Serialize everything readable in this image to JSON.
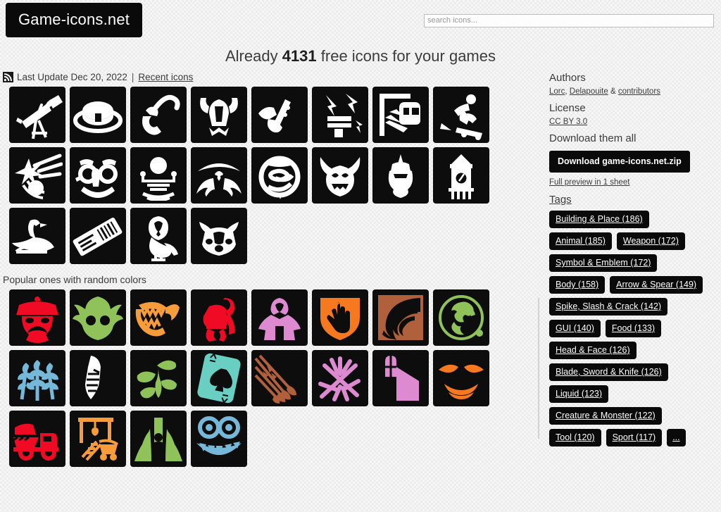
{
  "site": {
    "logo": "Game-icons.net",
    "headline_prefix": "Already ",
    "headline_count": "4131",
    "headline_suffix": " free icons for your games"
  },
  "search": {
    "placeholder": "search icons...",
    "value": "",
    "icon": "search-icon"
  },
  "update": {
    "rss_icon": "rss-feed-icon",
    "text": "Last Update Dec 20, 2022",
    "separator": "|",
    "recent_link": "Recent icons"
  },
  "sections": {
    "recent_title": "",
    "popular_title": "Popular ones with random colors"
  },
  "recent_icons": [
    {
      "name": "telescope-icon",
      "label": "Telescope"
    },
    {
      "name": "boater-hat-icon",
      "label": "Boater Hat"
    },
    {
      "name": "smoking-pipe-icon",
      "label": "Smoking Pipe"
    },
    {
      "name": "horned-helm-icon",
      "label": "Horned Helm"
    },
    {
      "name": "hand-grenade-icon",
      "label": "Hand Holding Vial"
    },
    {
      "name": "thunder-anvil-icon",
      "label": "Thunder Struck Anvil"
    },
    {
      "name": "subway-train-icon",
      "label": "Subway Train"
    },
    {
      "name": "skateboarder-icon",
      "label": "Skateboarder"
    },
    {
      "name": "comet-spark-icon",
      "label": "Comet Spark"
    },
    {
      "name": "groucho-glasses-icon",
      "label": "Groucho Glasses"
    },
    {
      "name": "orrery-icon",
      "label": "Orrery"
    },
    {
      "name": "manta-ray-icon",
      "label": "Manta Ray"
    },
    {
      "name": "planet-emblem-icon",
      "label": "Planet Emblem"
    },
    {
      "name": "goblin-head-icon",
      "label": "Goblin Head"
    },
    {
      "name": "knight-helm-icon",
      "label": "Knight Helm"
    },
    {
      "name": "clock-tower-icon",
      "label": "Clock Tower"
    },
    {
      "name": "goose-icon",
      "label": "Goose"
    },
    {
      "name": "boarding-pass-icon",
      "label": "Boarding Pass"
    },
    {
      "name": "barn-owl-icon",
      "label": "Barn Owl"
    },
    {
      "name": "badger-head-icon",
      "label": "Badger Head"
    }
  ],
  "popular_icons": [
    {
      "name": "police-officer-head-icon",
      "label": "Police Officer Head",
      "color": "#f00a23"
    },
    {
      "name": "fish-monster-head-icon",
      "label": "Fish Monster Head",
      "color": "#8fc359"
    },
    {
      "name": "shark-bite-icon",
      "label": "Shark Bite",
      "color": "#f79c3a"
    },
    {
      "name": "gorilla-icon",
      "label": "Gorilla",
      "color": "#f00a23"
    },
    {
      "name": "hooded-figure-icon",
      "label": "Hooded Figure",
      "color": "#dd8ad0"
    },
    {
      "name": "hand-shield-icon",
      "label": "Hand Shield",
      "color": "#f6791f"
    },
    {
      "name": "spiral-shell-icon",
      "label": "Spiral Shell",
      "color": "#b0603a"
    },
    {
      "name": "earth-globe-icon",
      "label": "Earth Globe",
      "color": "#8fc359"
    },
    {
      "name": "wheat-icon",
      "label": "Wheat",
      "color": "#75b8d9"
    },
    {
      "name": "gauntlet-icon",
      "label": "Gauntlet",
      "color": "#ffffff"
    },
    {
      "name": "sprout-icon",
      "label": "Sprout",
      "color": "#8fc359"
    },
    {
      "name": "ace-of-spades-icon",
      "label": "Ace Of Spades",
      "color": "#69cfc2"
    },
    {
      "name": "arrow-cluster-icon",
      "label": "Arrow Cluster",
      "color": "#b0603a"
    },
    {
      "name": "crossed-sticks-icon",
      "label": "Crossed Sticks",
      "color": "#dd8ad0"
    },
    {
      "name": "prison-window-icon",
      "label": "Prison Window",
      "color": "#dd8ad0"
    },
    {
      "name": "devil-mask-icon",
      "label": "Devil Mask",
      "color": "#f6791f"
    },
    {
      "name": "dump-truck-icon",
      "label": "Dump Truck",
      "color": "#f00a23"
    },
    {
      "name": "mine-wagon-icon",
      "label": "Mine Wagon",
      "color": "#f79c3a"
    },
    {
      "name": "hiding-in-grass-icon",
      "label": "Hiding In Grass",
      "color": "#8fc359"
    },
    {
      "name": "monster-grin-icon",
      "label": "Monster Grin",
      "color": "#75b8d9"
    }
  ],
  "sidebar": {
    "authors_heading": "Authors",
    "authors": [
      {
        "label": "Lorc"
      },
      {
        "label": "Delapouite"
      },
      {
        "label": "contributors"
      }
    ],
    "authors_sep1": ", ",
    "authors_sep2": " & ",
    "license_heading": "License",
    "license_link": "CC BY 3.0",
    "download_heading": "Download them all",
    "download_button": "Download game-icons.net.zip",
    "preview_link": "Full preview in 1 sheet",
    "tags_heading": "Tags",
    "tags": [
      {
        "label": "Building & Place (186)"
      },
      {
        "label": "Animal (185)"
      },
      {
        "label": "Weapon (172)"
      },
      {
        "label": "Symbol & Emblem (172)"
      },
      {
        "label": "Body (158)"
      },
      {
        "label": "Arrow & Spear (149)"
      },
      {
        "label": "Spike, Slash & Crack (142)"
      },
      {
        "label": "GUI (140)"
      },
      {
        "label": "Food (133)"
      },
      {
        "label": "Head & Face (126)"
      },
      {
        "label": "Blade, Sword & Knife (126)"
      },
      {
        "label": "Liquid (123)"
      },
      {
        "label": "Creature & Monster (122)"
      },
      {
        "label": "Tool (120)"
      },
      {
        "label": "Sport (117)"
      },
      {
        "label": "..."
      }
    ]
  },
  "colors": {
    "tile_bg": "#0d0d0d",
    "page_bg": "#ececec",
    "text": "#3b3b3b",
    "chip_bg": "#0a0a0a"
  }
}
